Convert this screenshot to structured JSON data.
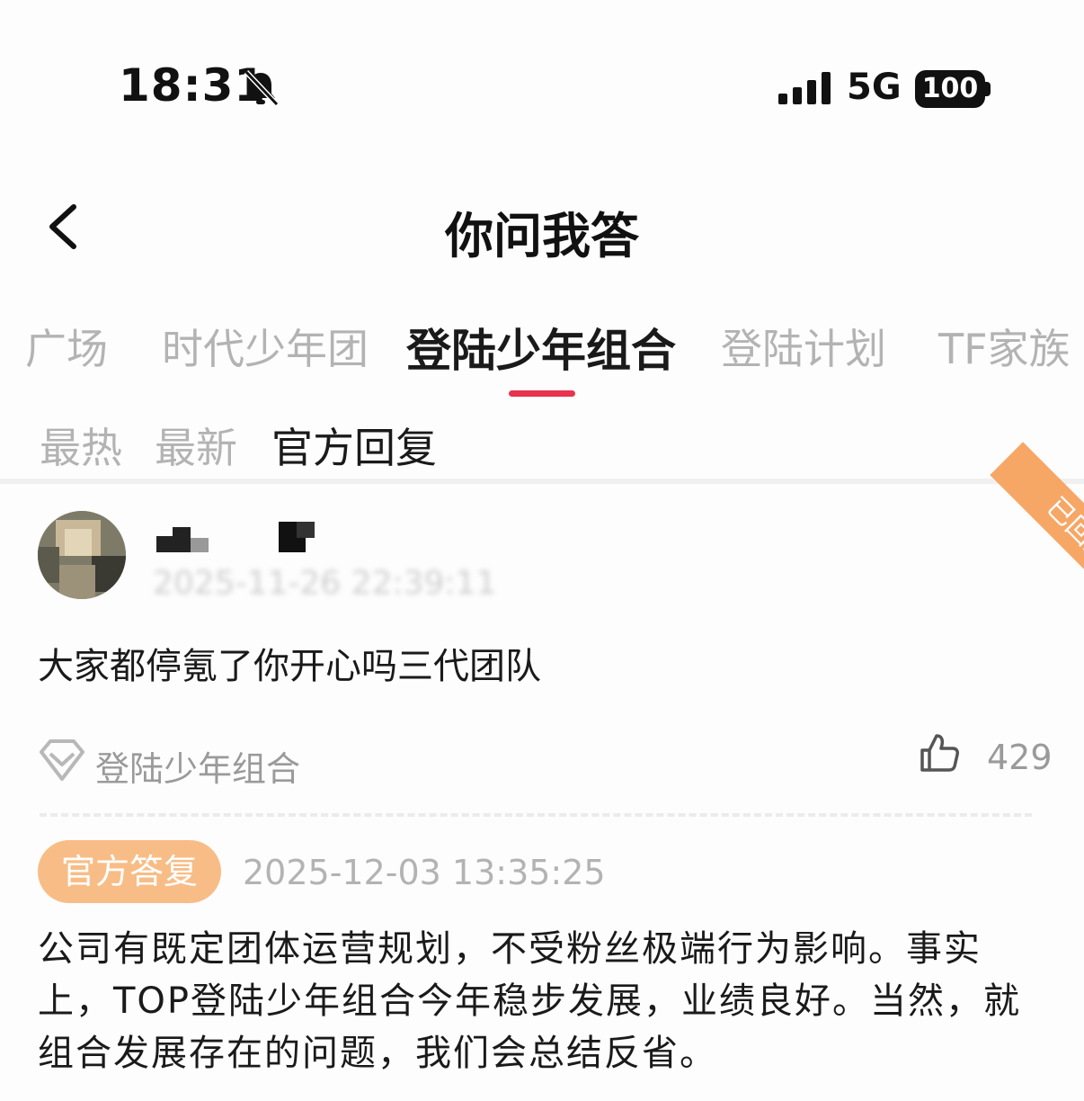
{
  "status_bar": {
    "time": "18:31",
    "network": "5G",
    "battery": "100"
  },
  "header": {
    "title": "你问我答"
  },
  "tabs": [
    {
      "label": "广场"
    },
    {
      "label": "时代少年团"
    },
    {
      "label": "登陆少年组合"
    },
    {
      "label": "登陆计划"
    },
    {
      "label": "TF家族"
    }
  ],
  "active_tab_index": 2,
  "subtabs": [
    {
      "label": "最热"
    },
    {
      "label": "最新"
    },
    {
      "label": "官方回复"
    }
  ],
  "active_subtab_index": 2,
  "question": {
    "status_ribbon": "已回复",
    "timestamp": "2025-11-26 22:39:11",
    "text": "大家都停氪了你开心吗三代团队",
    "topic": "登陆少年组合",
    "likes": "429"
  },
  "answer": {
    "badge": "官方答复",
    "timestamp": "2025-12-03 13:35:25",
    "text": "公司有既定团体运营规划，不受粉丝极端行为影响。事实上，TOP登陆少年组合今年稳步发展，业绩良好。当然，就组合发展存在的问题，我们会总结反省。"
  },
  "colors": {
    "accent": "#e8344e",
    "ribbon": "#f6a766",
    "official_badge": "#f8bd86"
  }
}
